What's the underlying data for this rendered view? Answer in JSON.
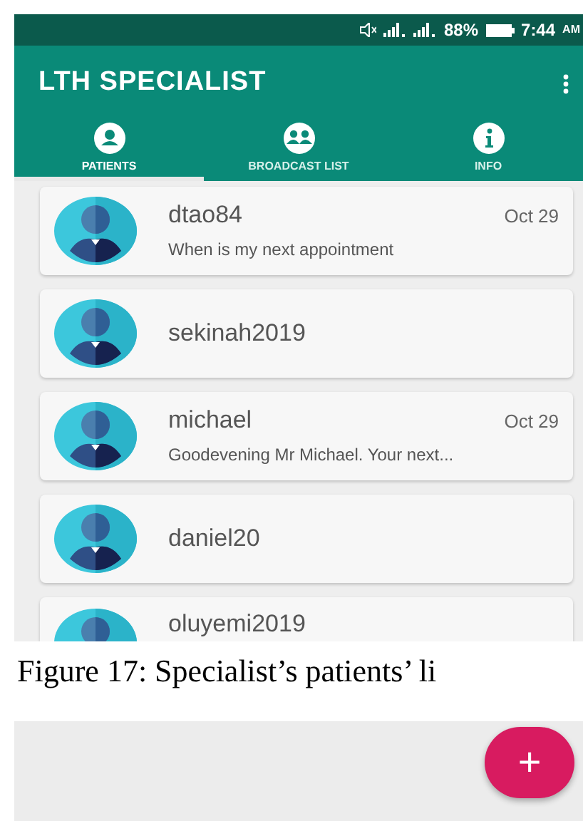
{
  "status_bar": {
    "battery": "88%",
    "time": "7:44",
    "time_suffix": "AM"
  },
  "app_bar": {
    "title": "LTH SPECIALIST"
  },
  "tabs": [
    {
      "label": "PATIENTS",
      "kind": "person",
      "selected": true
    },
    {
      "label": "BROADCAST LIST",
      "kind": "group",
      "selected": false
    },
    {
      "label": "INFO",
      "kind": "info",
      "selected": false
    }
  ],
  "chats": [
    {
      "name": "dtao84",
      "date": "Oct 29",
      "message": "When is my next appointment"
    },
    {
      "name": "sekinah2019"
    },
    {
      "name": "michael",
      "date": "Oct 29",
      "message": "Goodevening Mr Michael. Your next..."
    },
    {
      "name": "daniel20"
    },
    {
      "name": "oluyemi2019"
    }
  ],
  "caption": "Figure 17: Specialist’s patients’ li",
  "fab": {
    "label": "+"
  }
}
